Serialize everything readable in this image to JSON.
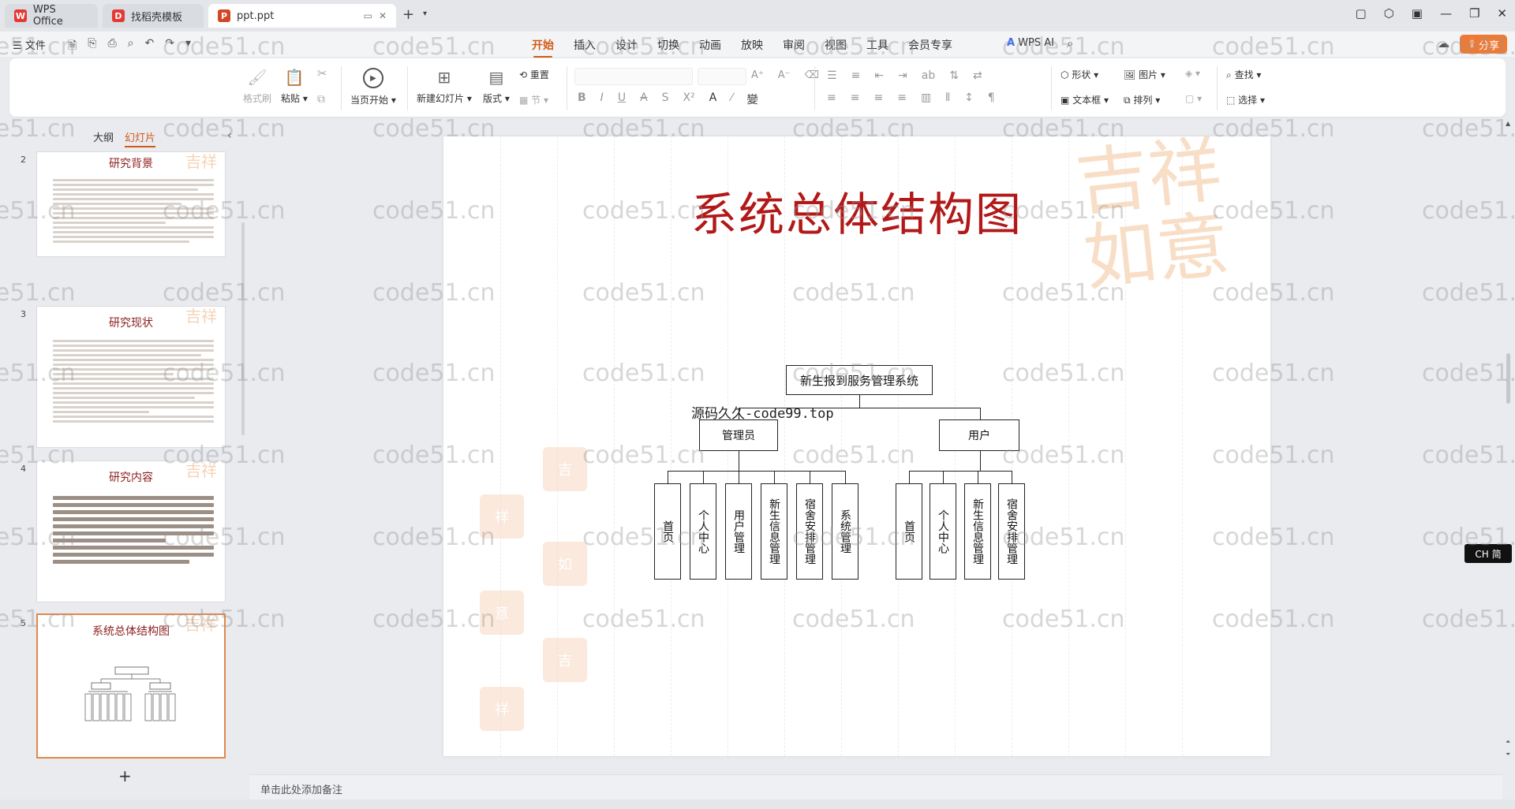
{
  "tabs": [
    {
      "label": "WPS Office",
      "icon": "wps-logo-icon",
      "color": "#e53935"
    },
    {
      "label": "找稻壳模板",
      "icon": "docer-icon",
      "color": "#e53935"
    },
    {
      "label": "ppt.ppt",
      "icon": "ppt-file-icon",
      "color": "#d24726"
    }
  ],
  "menu": {
    "file": "文件",
    "ribbon_tabs": [
      "开始",
      "插入",
      "设计",
      "切换",
      "动画",
      "放映",
      "审阅",
      "视图",
      "工具",
      "会员专享"
    ],
    "active_tab": "开始",
    "wps_ai": "WPS AI",
    "share": "分享"
  },
  "ribbon": {
    "format_painter": "格式刷",
    "paste": "粘贴",
    "start_show": "当页开始",
    "new_slide": "新建幻灯片",
    "layout": "版式",
    "reset": "重置",
    "section": "节",
    "shape": "形状",
    "picture": "图片",
    "textbox": "文本框",
    "arrange": "排列",
    "find": "查找",
    "select": "选择"
  },
  "left_panel": {
    "outline_tab": "大纲",
    "slides_tab": "幻灯片",
    "slides": [
      {
        "num": "2",
        "title": "研究背景"
      },
      {
        "num": "3",
        "title": "研究现状"
      },
      {
        "num": "4",
        "title": "研究内容"
      },
      {
        "num": "5",
        "title": "系统总体结构图"
      }
    ]
  },
  "slide": {
    "title": "系统总体结构图",
    "source_note": "源码久久-code99.top",
    "root": "新生报到服务管理系统",
    "admin": {
      "label": "管理员",
      "children": [
        "首页",
        "个人中心",
        "用户管理",
        "新生信息管理",
        "宿舍安排管理",
        "系统管理"
      ]
    },
    "user": {
      "label": "用户",
      "children": [
        "首页",
        "个人中心",
        "新生信息管理",
        "宿舍安排管理"
      ]
    }
  },
  "notes_placeholder": "单击此处添加备注",
  "ime_badge": "CH 简",
  "watermark_text": "code51.cn"
}
